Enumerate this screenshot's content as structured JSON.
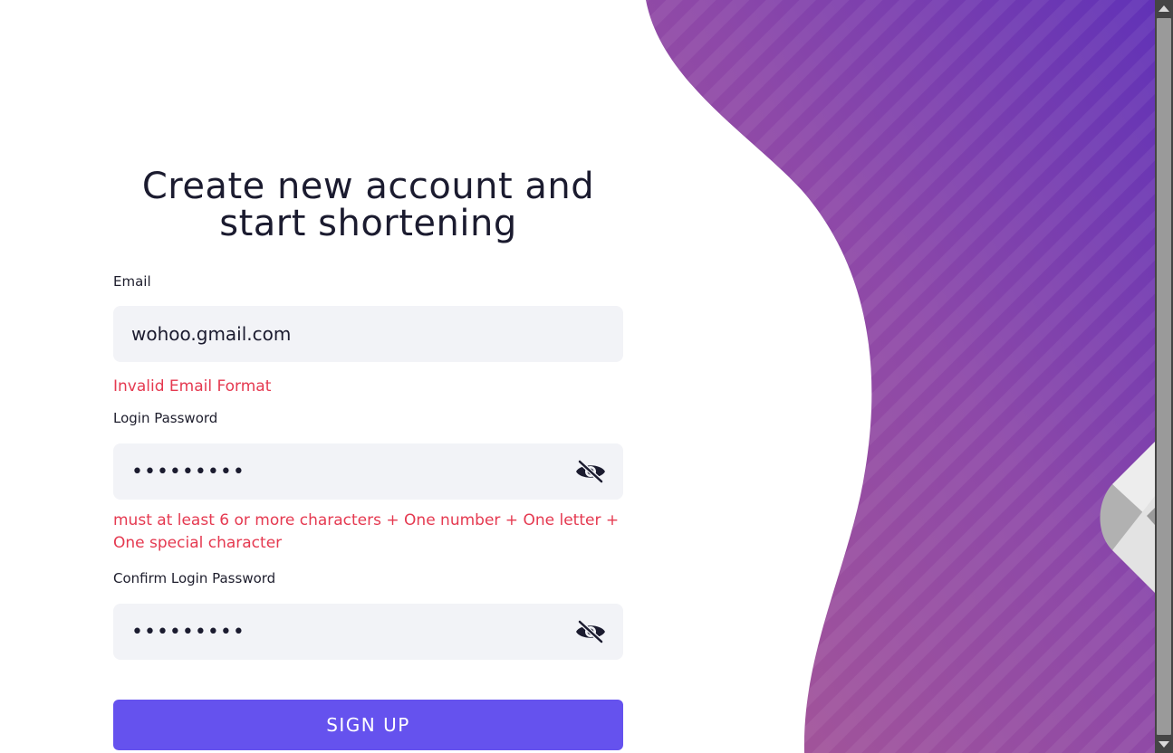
{
  "page": {
    "title_line1": "Create new account and",
    "title_line2": "start shortening"
  },
  "form": {
    "email": {
      "label": "Email",
      "value": "wohoo.gmail.com",
      "error": "Invalid Email Format"
    },
    "password": {
      "label": "Login Password",
      "value": "•••••••••",
      "error_line1": "must at least 6 or more characters + One number + One letter +",
      "error_line2": "One special character",
      "toggle_icon": "eye-off-icon"
    },
    "confirm_password": {
      "label": "Confirm Login Password",
      "value": "•••••••••",
      "toggle_icon": "eye-off-icon"
    },
    "submit_label": "SIGN UP"
  },
  "colors": {
    "accent": "#6552ee",
    "error": "#e53950",
    "input_bg": "#f2f3f7",
    "gradient_top": "#6a35b5",
    "gradient_bottom": "#a2579a"
  }
}
